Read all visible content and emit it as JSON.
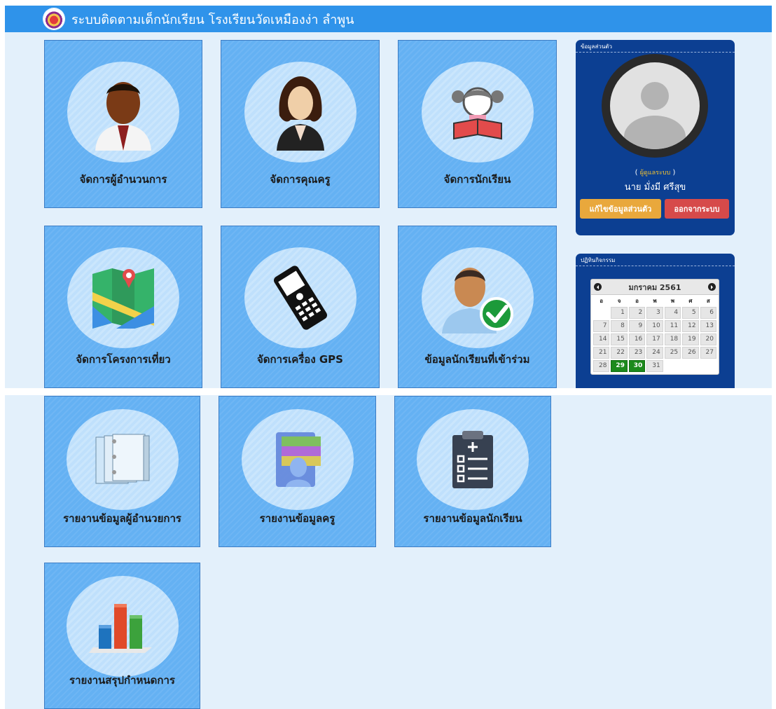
{
  "header": {
    "title": "ระบบติดตามเด็กนักเรียน โรงเรียนวัดเหมืองง่า ลำพูน"
  },
  "tiles": [
    {
      "label": "จัดการผู้อำนวนการ",
      "icon": "director-icon"
    },
    {
      "label": "จัดการคุณครู",
      "icon": "teacher-icon"
    },
    {
      "label": "จัดการนักเรียน",
      "icon": "student-reading-icon"
    },
    {
      "label": "จัดการโครงการเที่ยว",
      "icon": "map-icon"
    },
    {
      "label": "จัดการเครื่อง GPS",
      "icon": "gps-device-icon"
    },
    {
      "label": "ข้อมูลนักเรียนที่เข้าร่วม",
      "icon": "participant-check-icon"
    },
    {
      "label": "รายงานข้อมูลผู้อำนวยการ",
      "icon": "books-icon"
    },
    {
      "label": "รายงานข้อมูลครู",
      "icon": "contact-cards-icon"
    },
    {
      "label": "รายงานข้อมูลนักเรียน",
      "icon": "clipboard-icon"
    },
    {
      "label": "รายงานสรุปกำหนดการ",
      "icon": "bar-chart-icon"
    }
  ],
  "profile": {
    "heading": "ข้อมูลส่วนตัว",
    "role_open": "(",
    "role": "ผู้ดูแลระบบ",
    "role_close": ")",
    "name": "นาย มั่งมี ศรีสุข",
    "edit_button": "แก้ไขข้อมูลส่วนตัว",
    "logout_button": "ออกจากระบบ"
  },
  "calendar": {
    "heading": "ปฏิทินกิจกรรม",
    "month_label": "มกราคม 2561",
    "weekdays": [
      "อ",
      "จ",
      "อ",
      "พ",
      "พ",
      "ศ",
      "ส"
    ],
    "days": [
      "",
      "1",
      "2",
      "3",
      "4",
      "5",
      "6",
      "7",
      "8",
      "9",
      "10",
      "11",
      "12",
      "13",
      "14",
      "15",
      "16",
      "17",
      "18",
      "19",
      "20",
      "21",
      "22",
      "23",
      "24",
      "25",
      "26",
      "27",
      "28",
      "29",
      "30",
      "31"
    ],
    "highlighted": [
      "29",
      "30"
    ]
  },
  "colors": {
    "topbar": "#2f93ea",
    "tile": "#64b1f3",
    "panel": "#0c3f92",
    "edit_button": "#e9a83c",
    "logout_button": "#d64a4a",
    "calendar_highlight": "#1c8a1c"
  }
}
